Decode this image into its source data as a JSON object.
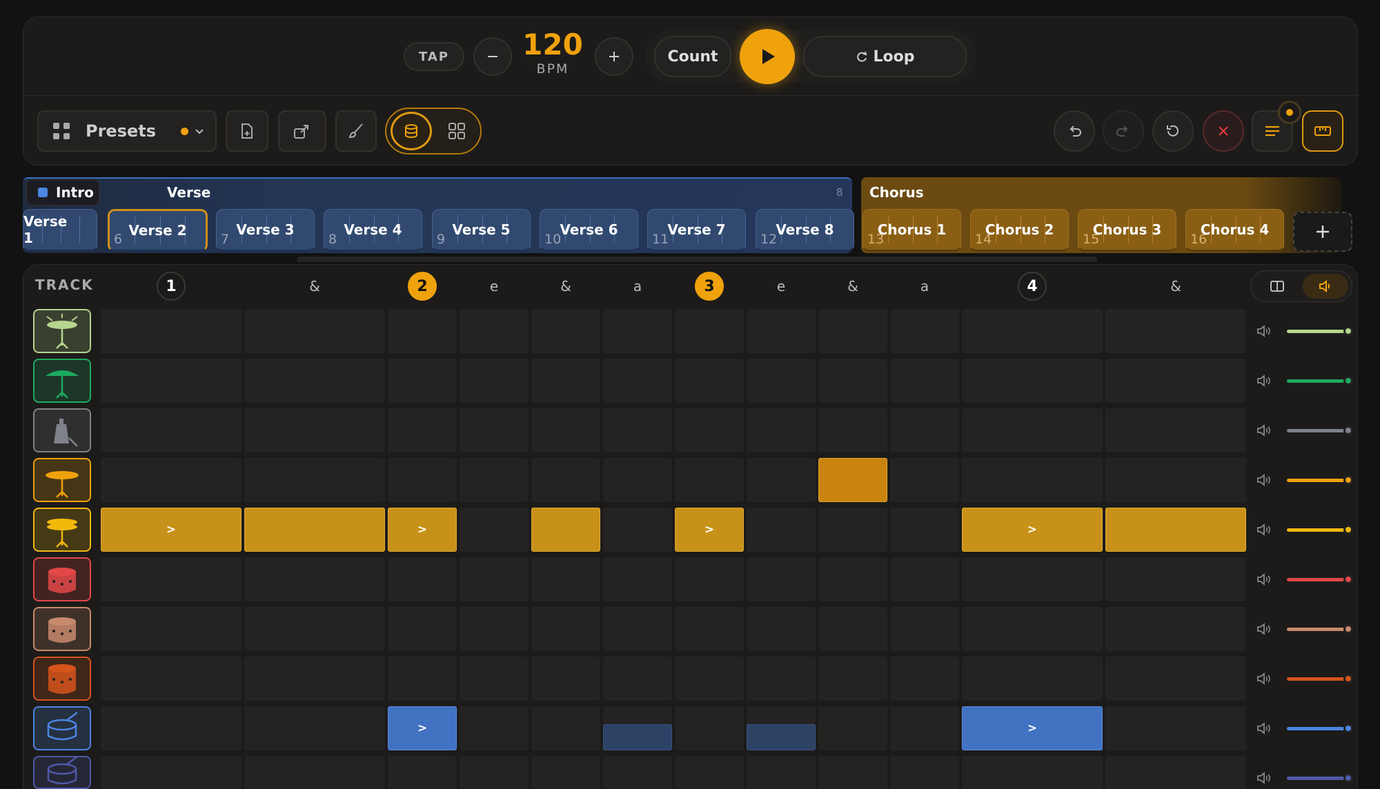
{
  "transport": {
    "tap_label": "TAP",
    "bpm_value": "120",
    "bpm_unit": "BPM",
    "count_label": "Count",
    "loop_label": "Loop"
  },
  "toolbar": {
    "presets_label": "Presets"
  },
  "sections": {
    "intro_label": "Intro",
    "verse_label": "Verse",
    "verse_count": "8",
    "chorus_label": "Chorus"
  },
  "segments": [
    {
      "label": "Verse 1",
      "num": ""
    },
    {
      "label": "Verse 2",
      "num": "6"
    },
    {
      "label": "Verse 3",
      "num": "7"
    },
    {
      "label": "Verse 4",
      "num": "8"
    },
    {
      "label": "Verse 5",
      "num": "9"
    },
    {
      "label": "Verse 6",
      "num": "10"
    },
    {
      "label": "Verse 7",
      "num": "11"
    },
    {
      "label": "Verse 8",
      "num": "12"
    },
    {
      "label": "Chorus 1",
      "num": "13"
    },
    {
      "label": "Chorus 2",
      "num": "14"
    },
    {
      "label": "Chorus 3",
      "num": "15"
    },
    {
      "label": "Chorus 4",
      "num": "16"
    }
  ],
  "grid": {
    "track_header": "TRACK",
    "beats": [
      "1",
      "&",
      "2",
      "e",
      "&",
      "a",
      "3",
      "e",
      "&",
      "a",
      "4",
      "&"
    ],
    "accent_glyph": ">"
  },
  "colors": {
    "accent": "#f0a20c",
    "step_active": "#c8921a",
    "step_blue": "#4272c2",
    "verse_blue": "#2c4670",
    "chorus_gold": "#7a5410",
    "stop_red": "#e0393b"
  },
  "tracks": [
    {
      "icon": "crash-cymbal-icon",
      "color": "#b6d58e",
      "level": 1.0
    },
    {
      "icon": "splash-cymbal-icon",
      "color": "#1eaa60",
      "level": 1.0
    },
    {
      "icon": "cowbell-icon",
      "color": "#7f828a",
      "level": 1.0
    },
    {
      "icon": "ride-cymbal-icon",
      "color": "#f0a20c",
      "level": 1.0
    },
    {
      "icon": "hihat-icon",
      "color": "#f0b90c",
      "level": 1.0
    },
    {
      "icon": "snare-drum-icon",
      "color": "#e34848",
      "level": 1.0
    },
    {
      "icon": "tom-drum-icon",
      "color": "#c88a6c",
      "level": 1.0
    },
    {
      "icon": "floor-tom-icon",
      "color": "#d6541c",
      "level": 1.0
    },
    {
      "icon": "bass-drum-icon",
      "color": "#4b86e0",
      "level": 1.0
    },
    {
      "icon": "kick-drum-icon",
      "color": "#4e5aa8",
      "level": 1.0
    }
  ]
}
